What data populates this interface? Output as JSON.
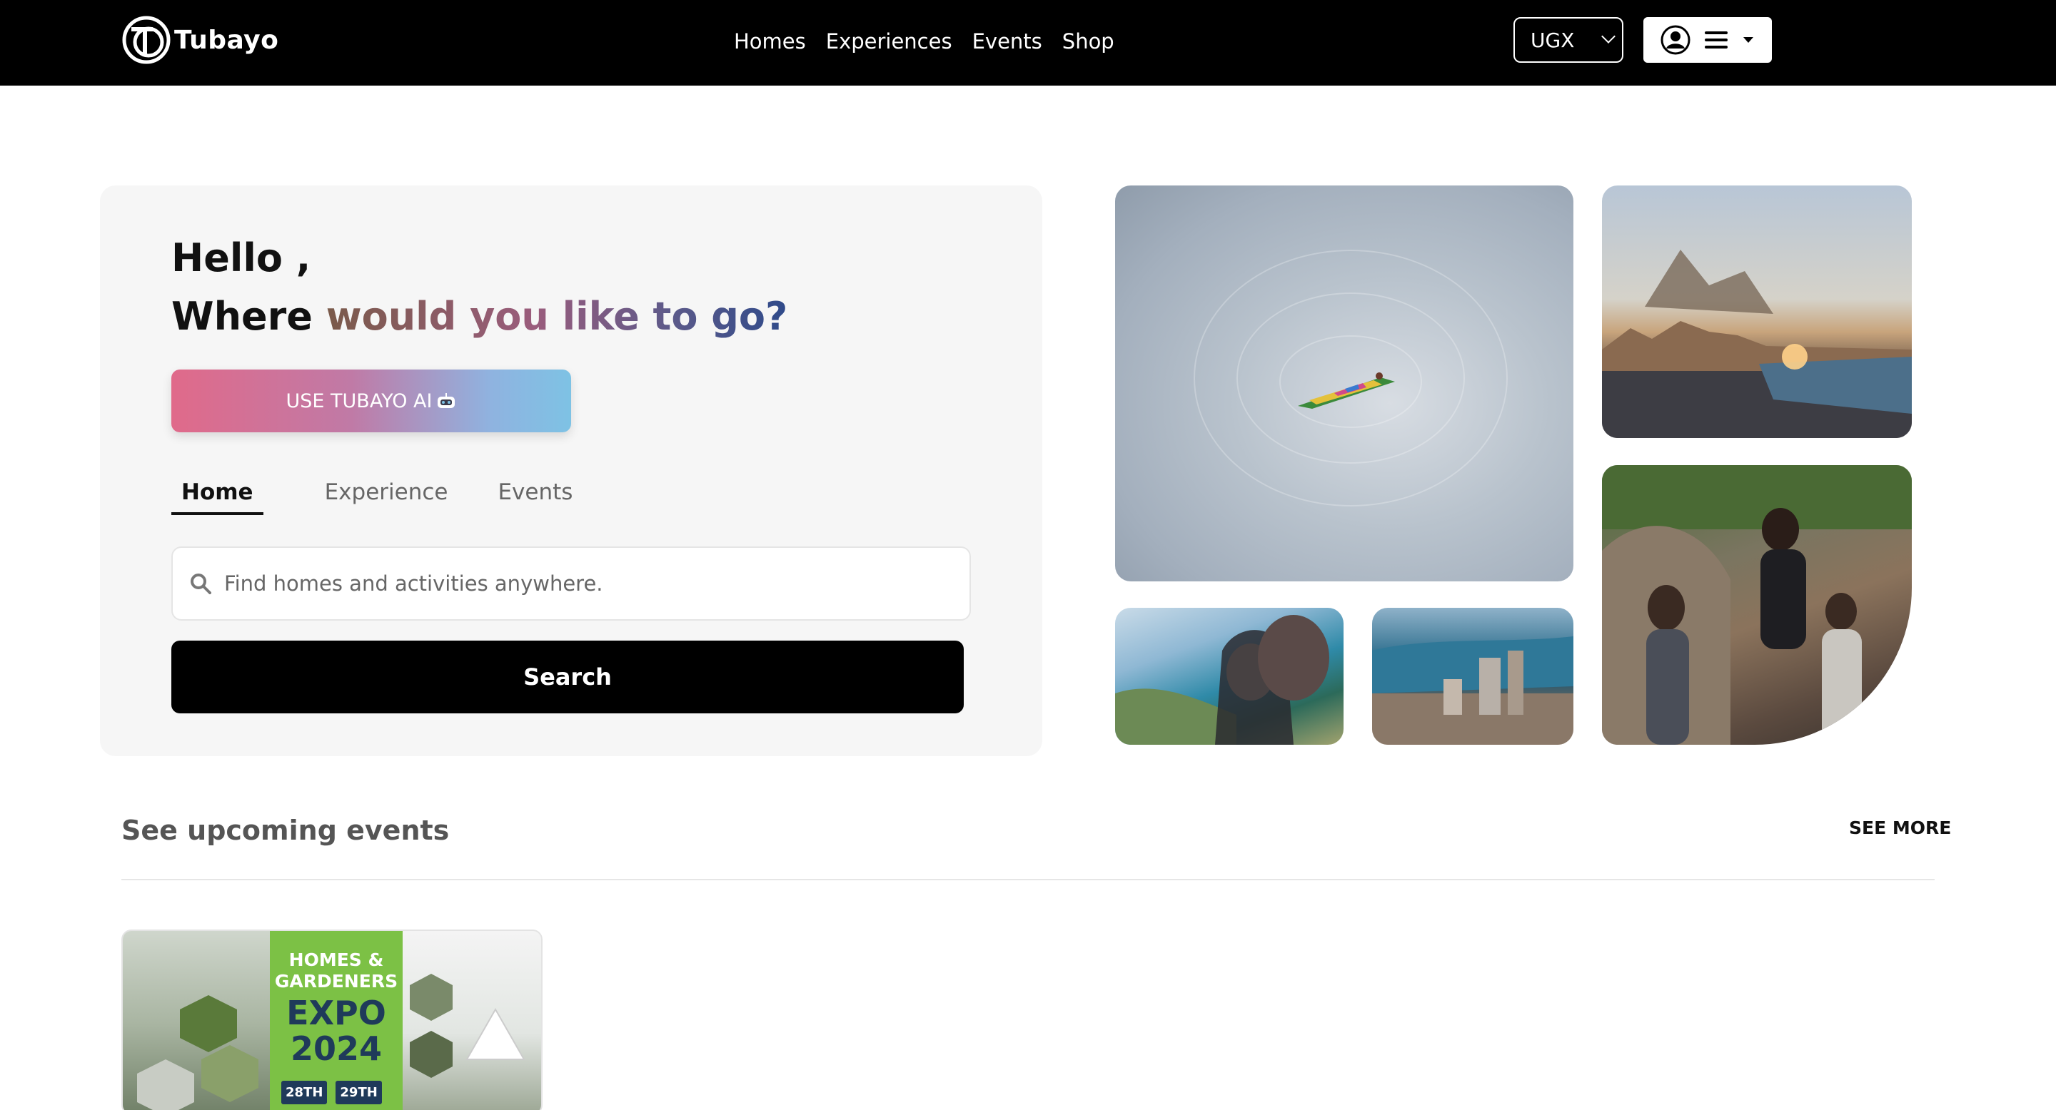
{
  "brand": {
    "name": "Tubayo"
  },
  "nav": {
    "items": [
      "Homes",
      "Experiences",
      "Events",
      "Shop"
    ]
  },
  "currency": {
    "selected": "UGX"
  },
  "hero": {
    "greeting": "Hello ,",
    "question_plain": "Where",
    "question_gradient": "would you like to go?",
    "ai_button_label": "USE TUBAYO AI",
    "tabs": [
      "Home",
      "Experience",
      "Events"
    ],
    "active_tab": "Home",
    "search_placeholder": "Find homes and activities anywhere.",
    "search_button_label": "Search"
  },
  "events_section": {
    "title": "See upcoming events",
    "see_more_label": "SEE MORE",
    "cards": [
      {
        "poster_line1": "HOMES &",
        "poster_line2": "GARDENERS",
        "poster_line3": "EXPO",
        "poster_line4": "2024",
        "date1": "28TH",
        "date2": "29TH"
      }
    ]
  },
  "colors": {
    "topbar": "#000000",
    "ai_gradient_start": "#e06a8a",
    "ai_gradient_end": "#7ec2e4",
    "search_button": "#000000",
    "expo_green": "#7cc145",
    "expo_navy": "#1f3a5a"
  },
  "icons": {
    "logo": "tubayo-logo-icon",
    "currency_caret": "chevron-down-icon",
    "user": "user-circle-icon",
    "menu": "hamburger-menu-icon",
    "menu_caret": "caret-down-icon",
    "ai": "robot-icon",
    "search": "search-icon"
  }
}
